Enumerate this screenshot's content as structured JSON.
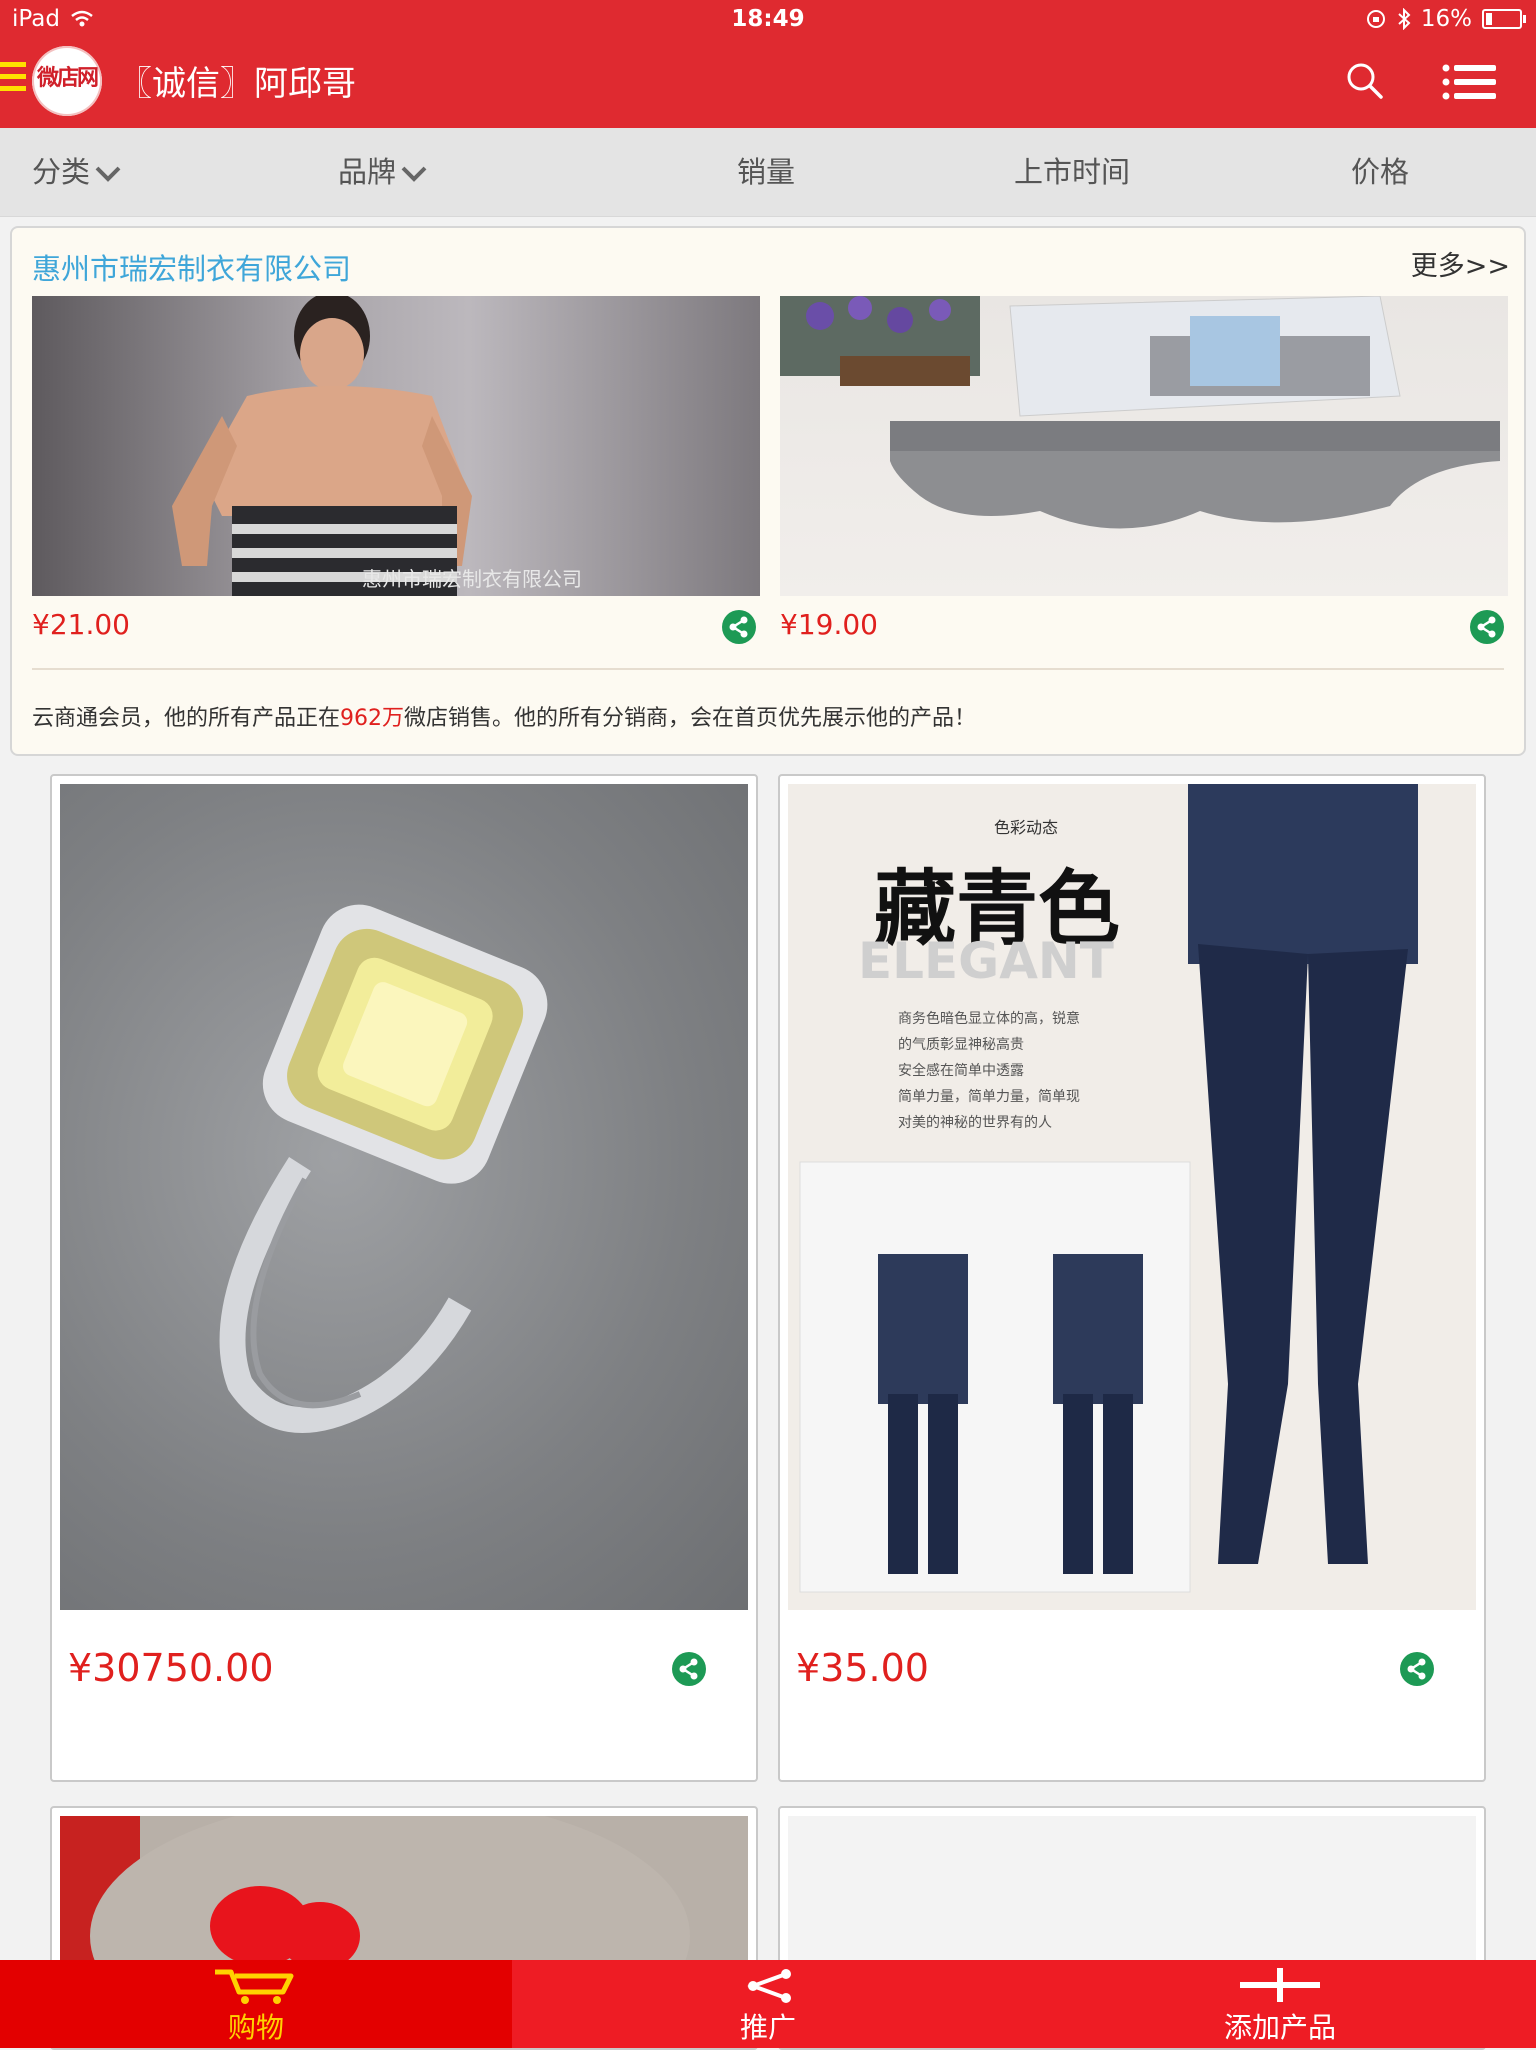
{
  "status_bar": {
    "device": "iPad",
    "time": "18:49",
    "battery": "16%",
    "battery_level": 0.16
  },
  "header": {
    "logo_text": "微店网",
    "title": "〖诚信〗阿邱哥",
    "search_icon": "search-icon",
    "menu_icon": "list-menu-icon"
  },
  "filters": [
    {
      "label": "分类",
      "has_dropdown": true
    },
    {
      "label": "品牌",
      "has_dropdown": true
    },
    {
      "label": "销量",
      "has_dropdown": false
    },
    {
      "label": "上市时间",
      "has_dropdown": false
    },
    {
      "label": "价格",
      "has_dropdown": false
    }
  ],
  "featured": {
    "company": "惠州市瑞宏制衣有限公司",
    "more": "更多>>",
    "products": [
      {
        "price": "¥21.00",
        "image_watermark": "惠州市瑞宏制衣有限公司"
      },
      {
        "price": "¥19.00"
      }
    ],
    "notice_before": "云商通会员，他的所有产品正在",
    "notice_highlight": "962万",
    "notice_after": "微店销售。他的所有分销商，会在首页优先展示他的产品！"
  },
  "products": [
    {
      "price": "¥30750.00"
    },
    {
      "price": "¥35.00",
      "image_text": {
        "tag": "色彩动态",
        "title": "藏青色",
        "subtitle": "ELEGANT",
        "lines": [
          "商务色暗色显立体的高，锐意",
          "的气质彰显神秘高贵",
          "安全感在简单中透露",
          "简单力量，简单力量，简单现",
          "对美的神秘的世界有的人"
        ]
      }
    },
    {
      "price": ""
    },
    {
      "price": ""
    }
  ],
  "tabbar": [
    {
      "label": "购物",
      "icon": "cart-icon",
      "active": true
    },
    {
      "label": "推广",
      "icon": "share-icon",
      "active": false
    },
    {
      "label": "添加产品",
      "icon": "plus-icon",
      "active": false
    }
  ],
  "colors": {
    "brand_red": "#df2a30",
    "price_red": "#e0201e",
    "link_blue": "#3fa6d9",
    "share_green": "#1d9a55",
    "active_tab_yellow": "#ffd200"
  }
}
